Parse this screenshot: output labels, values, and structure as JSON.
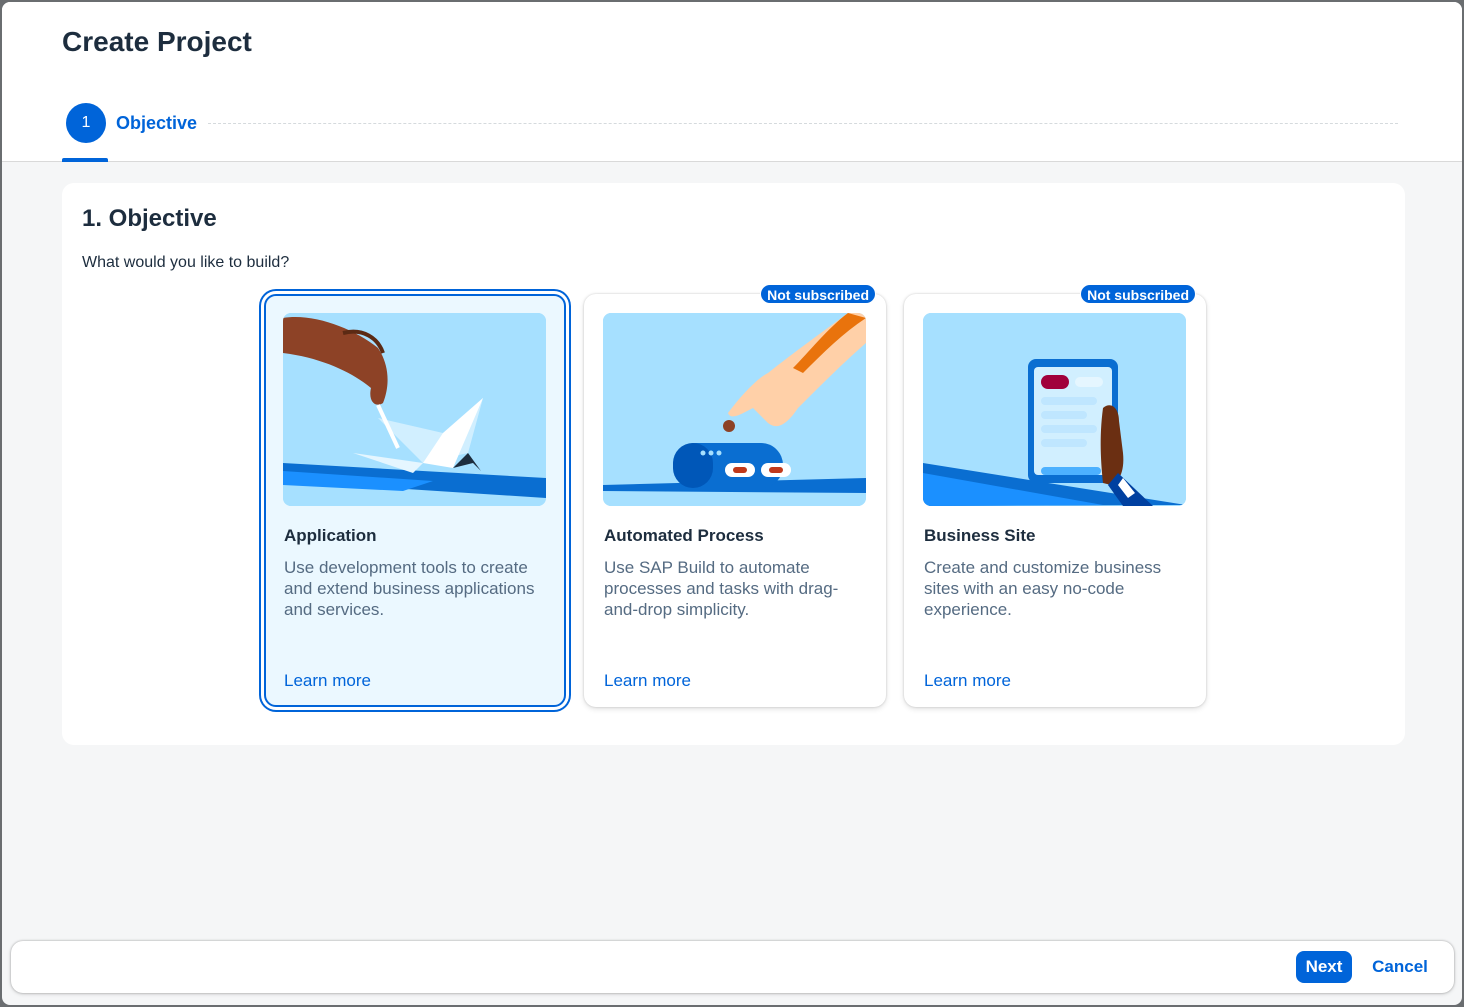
{
  "dialog": {
    "title": "Create Project",
    "steps": [
      {
        "number": "1",
        "label": "Objective"
      }
    ]
  },
  "panel": {
    "title": "1. Objective",
    "subtitle": "What would you like to build?"
  },
  "cards": [
    {
      "title": "Application",
      "description": "Use development tools to create and extend business applications and services.",
      "link": "Learn more",
      "selected": true,
      "illustration": "hand-folding-origami-crane"
    },
    {
      "title": "Automated Process",
      "description": "Use SAP Build to automate processes and tasks with drag-and-drop simplicity.",
      "link": "Learn more",
      "badge": "Not subscribed",
      "illustration": "hand-feeding-robot"
    },
    {
      "title": "Business Site",
      "description": "Create and customize business sites with an easy no-code experience.",
      "link": "Learn more",
      "badge": "Not subscribed",
      "illustration": "hand-holding-tablet"
    }
  ],
  "footer": {
    "next_label": "Next",
    "cancel_label": "Cancel"
  },
  "colors": {
    "accent": "#0064d9",
    "illustration_bg": "#a6e0ff",
    "selected_card_bg": "#ebf8ff"
  }
}
